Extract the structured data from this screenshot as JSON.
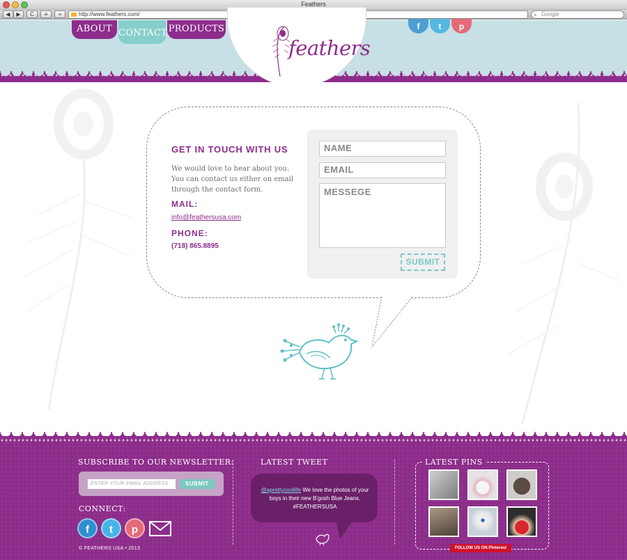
{
  "browser": {
    "window_title": "Feathers",
    "url": "http://www.feathers.com/",
    "search_placeholder": "Google",
    "back_label": "◀",
    "forward_label": "▶",
    "reload_label": "C",
    "add_label": "+"
  },
  "nav": {
    "about": "ABOUT",
    "contact": "CONTACT",
    "products": "PRODUCTS"
  },
  "logo": {
    "text": "feathers"
  },
  "social_top": {
    "facebook": "f",
    "twitter": "t",
    "pinterest": "p"
  },
  "contact": {
    "heading": "GET IN TOUCH WITH US",
    "intro": "We would love to hear about you. You can contact us either on email through the contact form.",
    "mail_label": "MAIL:",
    "email": "info@feathersusa.com",
    "phone_label": "PHONE:",
    "phone": "(718) 865.8895"
  },
  "form": {
    "name_placeholder": "NAME",
    "email_placeholder": "EMAIL",
    "message_placeholder": "MESSEGE",
    "submit_label": "SUBMIT"
  },
  "footer": {
    "newsletter_heading": "SUBSCRIBE TO OUR NEWSLETTER:",
    "newsletter_placeholder": "ENTER YOUR EMAIL ADDRESS",
    "newsletter_submit": "SUBMIT",
    "connect_heading": "CONNECT:",
    "copyright": "© FEATHERS USA • 2013",
    "tweet_heading": "LATEST TWEET",
    "tweet_handle": "@aprettycoollife",
    "tweet_text": " We love the photos of your boys in their new B'gosh Blue Jeans. #FEATHERSUSA",
    "pins_heading": "LATEST PINS",
    "pins_badge": "FOLLOW US ON Pinterest"
  },
  "colors": {
    "brand_purple": "#8d2d8b",
    "header_blue": "#c6e0e6",
    "accent_teal": "#7cc8c4",
    "facebook_blue": "#2f8fcf",
    "twitter_blue": "#46b5e5",
    "pinterest_pink": "#e56a78"
  }
}
